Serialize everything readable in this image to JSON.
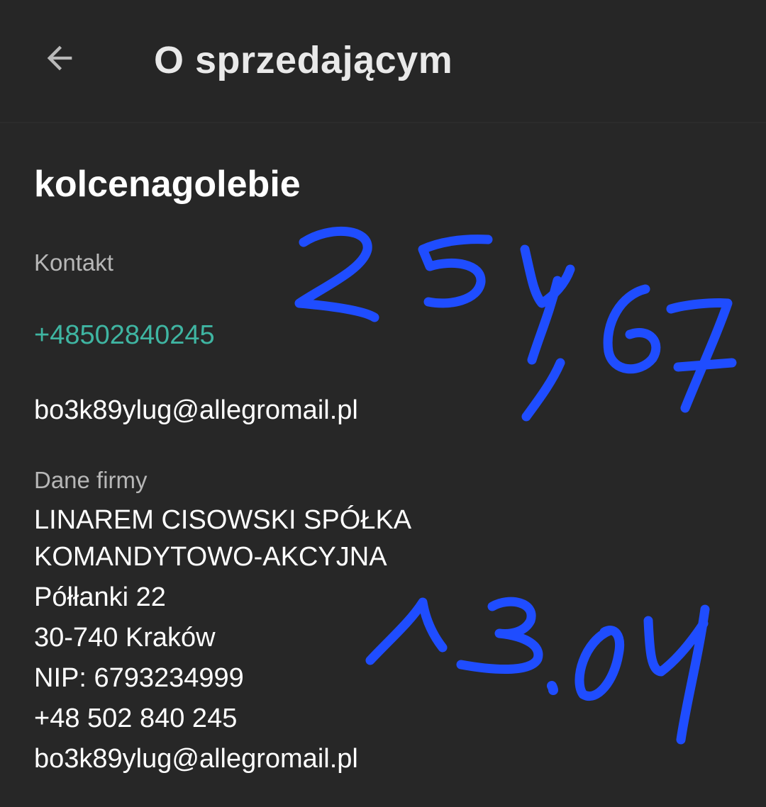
{
  "header": {
    "back_icon": "arrow-left-icon",
    "title": "O sprzedającym"
  },
  "seller": {
    "name": "kolcenagolebie"
  },
  "contact": {
    "label": "Kontakt",
    "phone": "+48502840245",
    "email": "bo3k89ylug@allegromail.pl"
  },
  "company": {
    "label": "Dane firmy",
    "lines": [
      "LINAREM CISOWSKI SPÓŁKA",
      "KOMANDYTOWO-AKCYJNA",
      "Półłanki 22",
      "30-740 Kraków",
      "NIP: 6793234999",
      "+48 502 840 245",
      "bo3k89ylug@allegromail.pl"
    ]
  },
  "annotations": {
    "amount": "254,67",
    "date": "13.04",
    "ink_color": "#1f4dff"
  },
  "colors": {
    "background": "#272727",
    "phone_accent": "#3fb5a2",
    "label_gray": "#b7b7b7"
  }
}
